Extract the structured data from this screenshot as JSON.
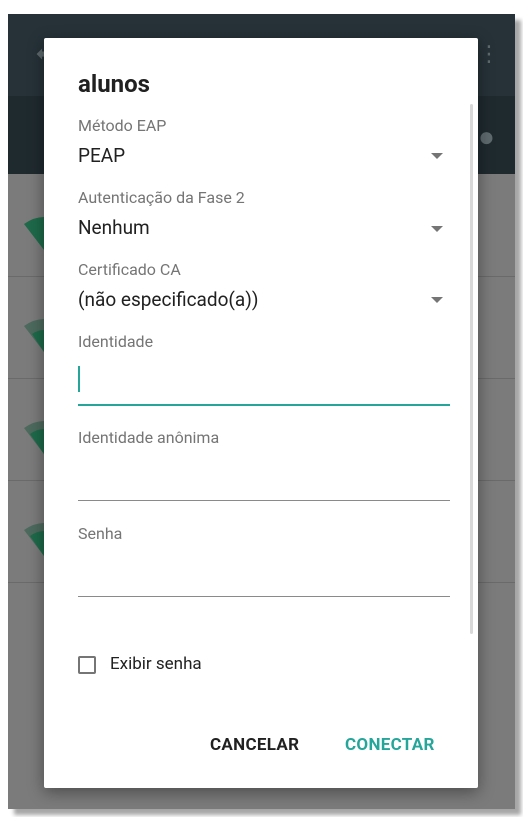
{
  "dialog": {
    "title": "alunos",
    "eap": {
      "label": "Método EAP",
      "value": "PEAP"
    },
    "phase2": {
      "label": "Autenticação da Fase 2",
      "value": "Nenhum"
    },
    "ca_cert": {
      "label": "Certificado CA",
      "value": "(não especificado(a))"
    },
    "identity": {
      "label": "Identidade",
      "value": ""
    },
    "anon_identity": {
      "label": "Identidade anônima",
      "value": ""
    },
    "password": {
      "label": "Senha",
      "value": ""
    },
    "show_password": {
      "label": "Exibir senha",
      "checked": false
    },
    "buttons": {
      "cancel": "CANCELAR",
      "connect": "CONECTAR"
    }
  },
  "colors": {
    "accent": "#26a69a",
    "appbar": "#263238",
    "scrim": "#7b7b7b"
  }
}
